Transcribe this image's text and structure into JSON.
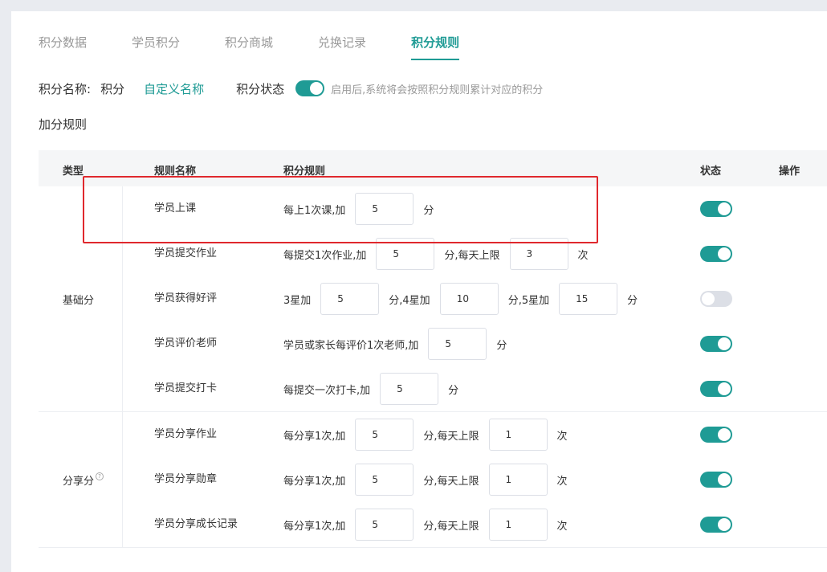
{
  "tabs": [
    {
      "label": "积分数据",
      "active": false
    },
    {
      "label": "学员积分",
      "active": false
    },
    {
      "label": "积分商城",
      "active": false
    },
    {
      "label": "兑换记录",
      "active": false
    },
    {
      "label": "积分规则",
      "active": true
    }
  ],
  "points_name": {
    "label": "积分名称:",
    "value": "积分",
    "custom_link": "自定义名称",
    "status_label": "积分状态",
    "status_on": true,
    "hint": "启用后,系统将会按照积分规则累计对应的积分"
  },
  "section_title": "加分规则",
  "table": {
    "headers": {
      "type": "类型",
      "name": "规则名称",
      "rule": "积分规则",
      "status": "状态",
      "action": "操作"
    },
    "groups": [
      {
        "type": "基础分",
        "rows": [
          {
            "name": "学员上课",
            "rule": [
              "每上1次课,加",
              {
                "input": "5"
              },
              "分"
            ],
            "on": true
          },
          {
            "name": "学员提交作业",
            "rule": [
              "每提交1次作业,加",
              {
                "input": "5"
              },
              "分,每天上限",
              {
                "input": "3"
              },
              "次"
            ],
            "on": true
          },
          {
            "name": "学员获得好评",
            "rule": [
              "3星加",
              {
                "input": "5"
              },
              "分,4星加",
              {
                "input": "10"
              },
              "分,5星加",
              {
                "input": "15"
              },
              "分"
            ],
            "on": false
          },
          {
            "name": "学员评价老师",
            "rule": [
              "学员或家长每评价1次老师,加",
              {
                "input": "5"
              },
              "分"
            ],
            "on": true
          },
          {
            "name": "学员提交打卡",
            "rule": [
              "每提交一次打卡,加",
              {
                "input": "5"
              },
              "分"
            ],
            "on": true
          }
        ]
      },
      {
        "type": "分享分",
        "help_icon": "question-circle-icon",
        "rows": [
          {
            "name": "学员分享作业",
            "rule": [
              "每分享1次,加",
              {
                "input": "5"
              },
              "分,每天上限",
              {
                "input": "1"
              },
              "次"
            ],
            "on": true
          },
          {
            "name": "学员分享勋章",
            "rule": [
              "每分享1次,加",
              {
                "input": "5"
              },
              "分,每天上限",
              {
                "input": "1"
              },
              "次"
            ],
            "on": true
          },
          {
            "name": "学员分享成长记录",
            "rule": [
              "每分享1次,加",
              {
                "input": "5"
              },
              "分,每天上限",
              {
                "input": "1"
              },
              "次"
            ],
            "on": true
          }
        ]
      }
    ]
  },
  "colors": {
    "accent": "#1f9b95",
    "highlight": "#e0282d"
  }
}
